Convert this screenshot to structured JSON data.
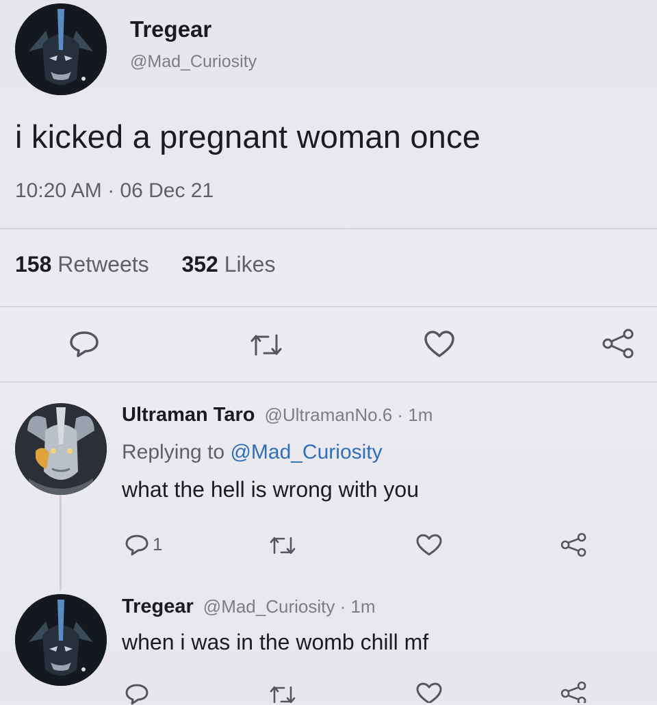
{
  "main_tweet": {
    "author_name": "Tregear",
    "author_handle": "@Mad_Curiosity",
    "text": "i kicked a pregnant woman once",
    "timestamp": "10:20 AM · 06 Dec 21",
    "retweets_count": "158",
    "retweets_label": "Retweets",
    "likes_count": "352",
    "likes_label": "Likes"
  },
  "replies": [
    {
      "author_name": "Ultraman Taro",
      "author_handle": "@UltramanNo.6 · 1m",
      "replying_prefix": "Replying to",
      "replying_to": "@Mad_Curiosity",
      "text": "what the hell is wrong with you",
      "reply_count": "1"
    },
    {
      "author_name": "Tregear",
      "author_handle": "@Mad_Curiosity · 1m",
      "text": "when i was in the womb chill mf"
    }
  ],
  "icons": {
    "reply": "reply-icon",
    "retweet": "retweet-icon",
    "like": "heart-icon",
    "share": "share-icon"
  },
  "colors": {
    "background": "#e9e8ee",
    "text": "#1b1b20",
    "secondary_text": "#5f5f69",
    "mention": "#2f6fb8",
    "divider": "#d6d5dc"
  }
}
